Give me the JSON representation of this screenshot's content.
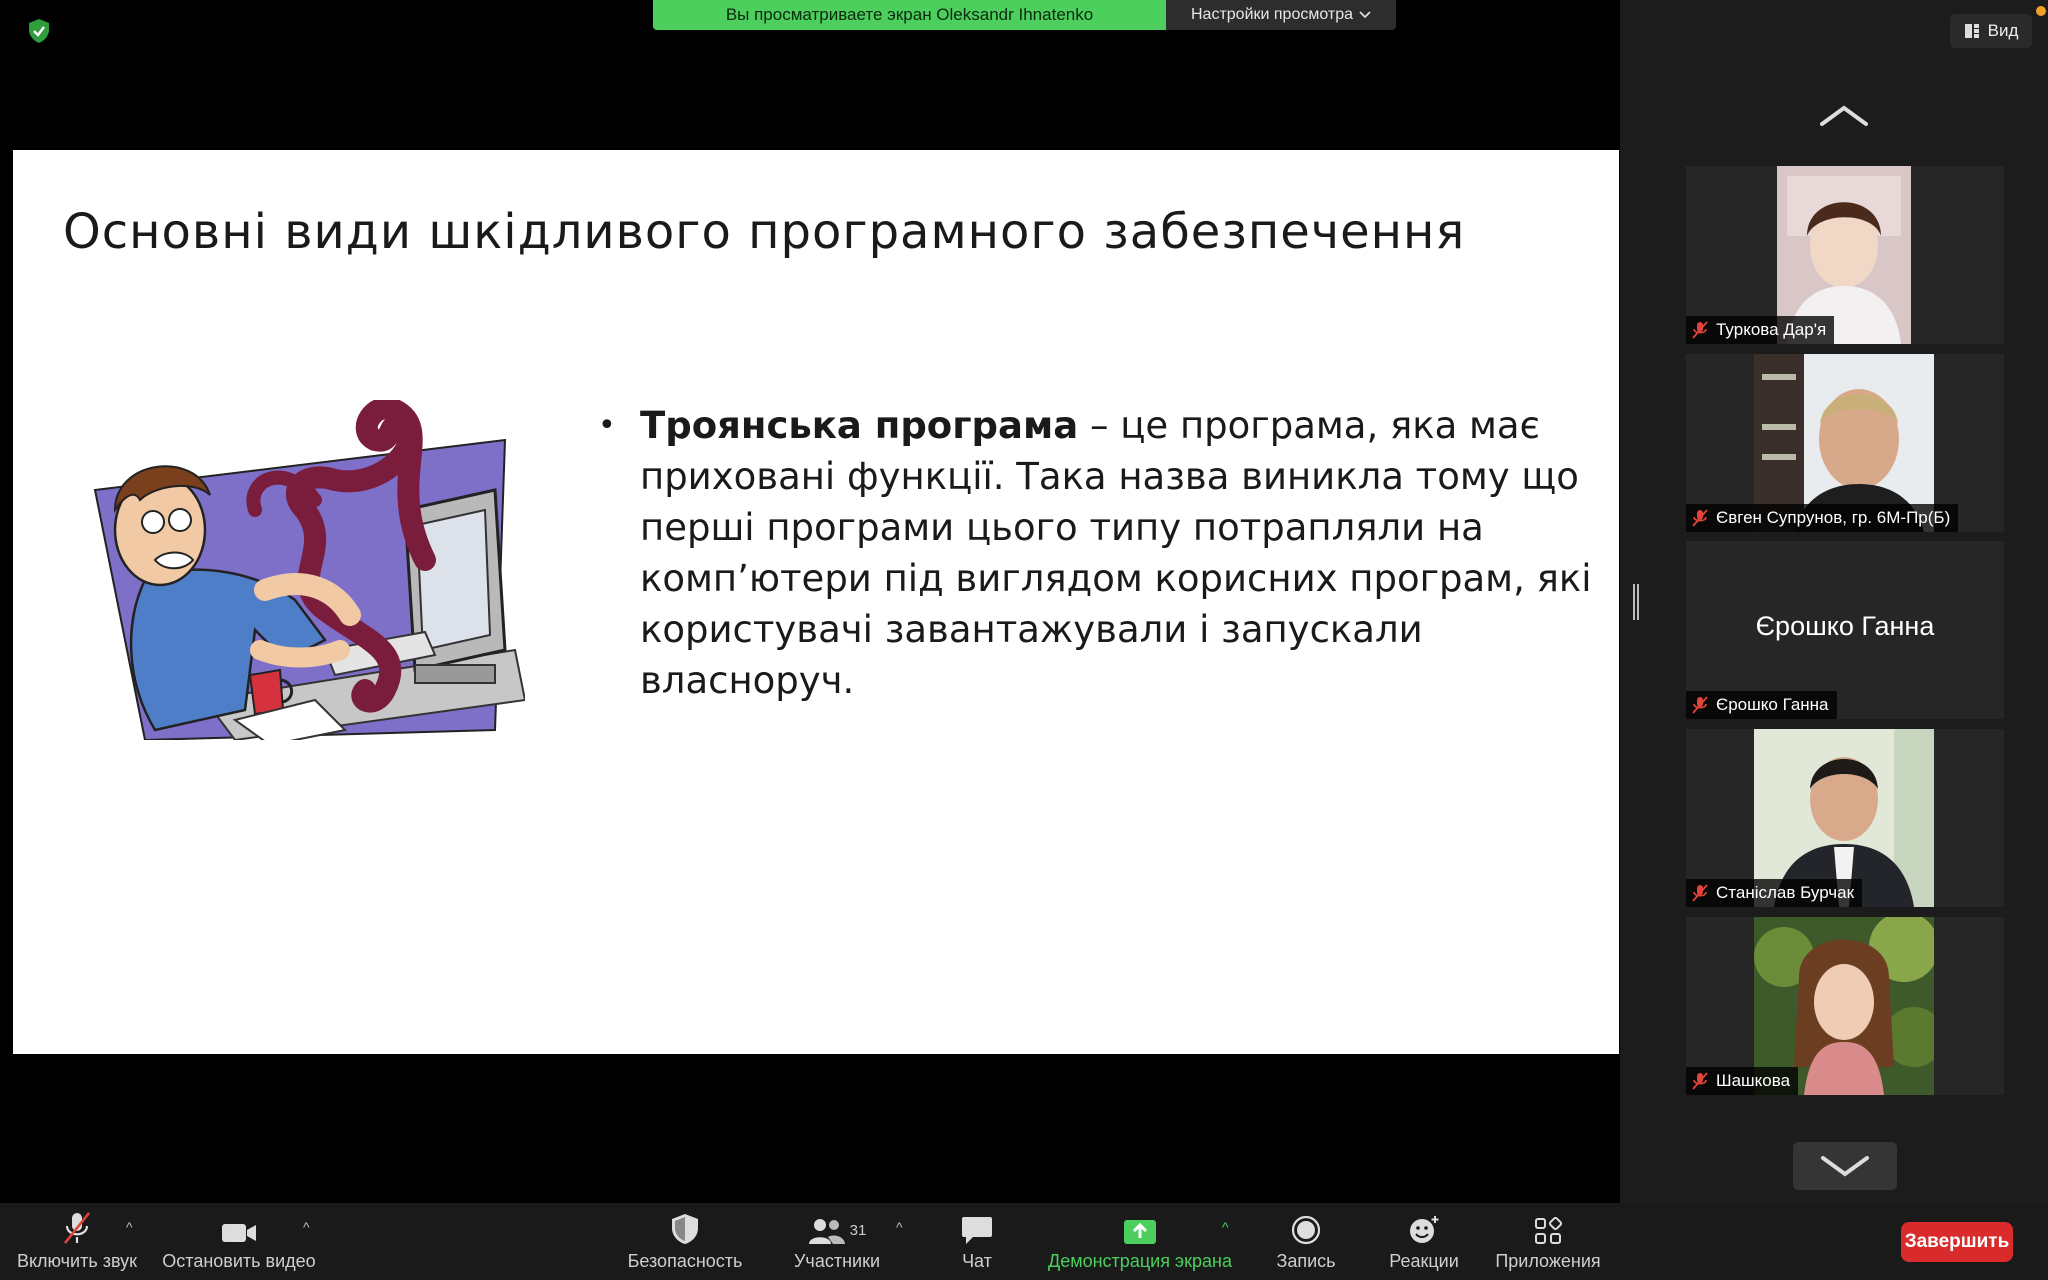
{
  "share_banner": {
    "message": "Вы просматриваете экран Oleksandr Ihnatenko",
    "options_label": "Настройки просмотра"
  },
  "slide": {
    "title": "Основні види шкідливого програмного забезпечення",
    "bullet_bold": "Троянська програма",
    "bullet_rest": " – це програма, яка має приховані функції. Така назва виникла тому що перші програми цього типу потрапляли на комп’ютери під виглядом корисних програм, які користувачі завантажували і запускали власноруч."
  },
  "sidebar": {
    "view_label": "Вид",
    "participants": [
      {
        "name": "Туркова Дар'я",
        "video": true,
        "muted": true
      },
      {
        "name": "Євген Супрунов, гр. 6М-Пр(Б)",
        "video": true,
        "muted": true
      },
      {
        "name": "Єрошко Ганна",
        "video": false,
        "muted": true,
        "display_name": "Єрошко Ганна"
      },
      {
        "name": "Станіслав Бурчак",
        "video": true,
        "muted": true
      },
      {
        "name": "Шашкова",
        "video": true,
        "muted": true
      }
    ]
  },
  "toolbar": {
    "unmute_label": "Включить звук",
    "video_label": "Остановить видео",
    "security_label": "Безопасность",
    "participants_label": "Участники",
    "participants_count": "31",
    "chat_label": "Чат",
    "share_label": "Демонстрация экрана",
    "record_label": "Запись",
    "reactions_label": "Реакции",
    "apps_label": "Приложения",
    "end_label": "Завершить"
  },
  "colors": {
    "share_green": "#4ccf5d",
    "end_red": "#d92b2b",
    "muted_red": "#e0443a"
  }
}
